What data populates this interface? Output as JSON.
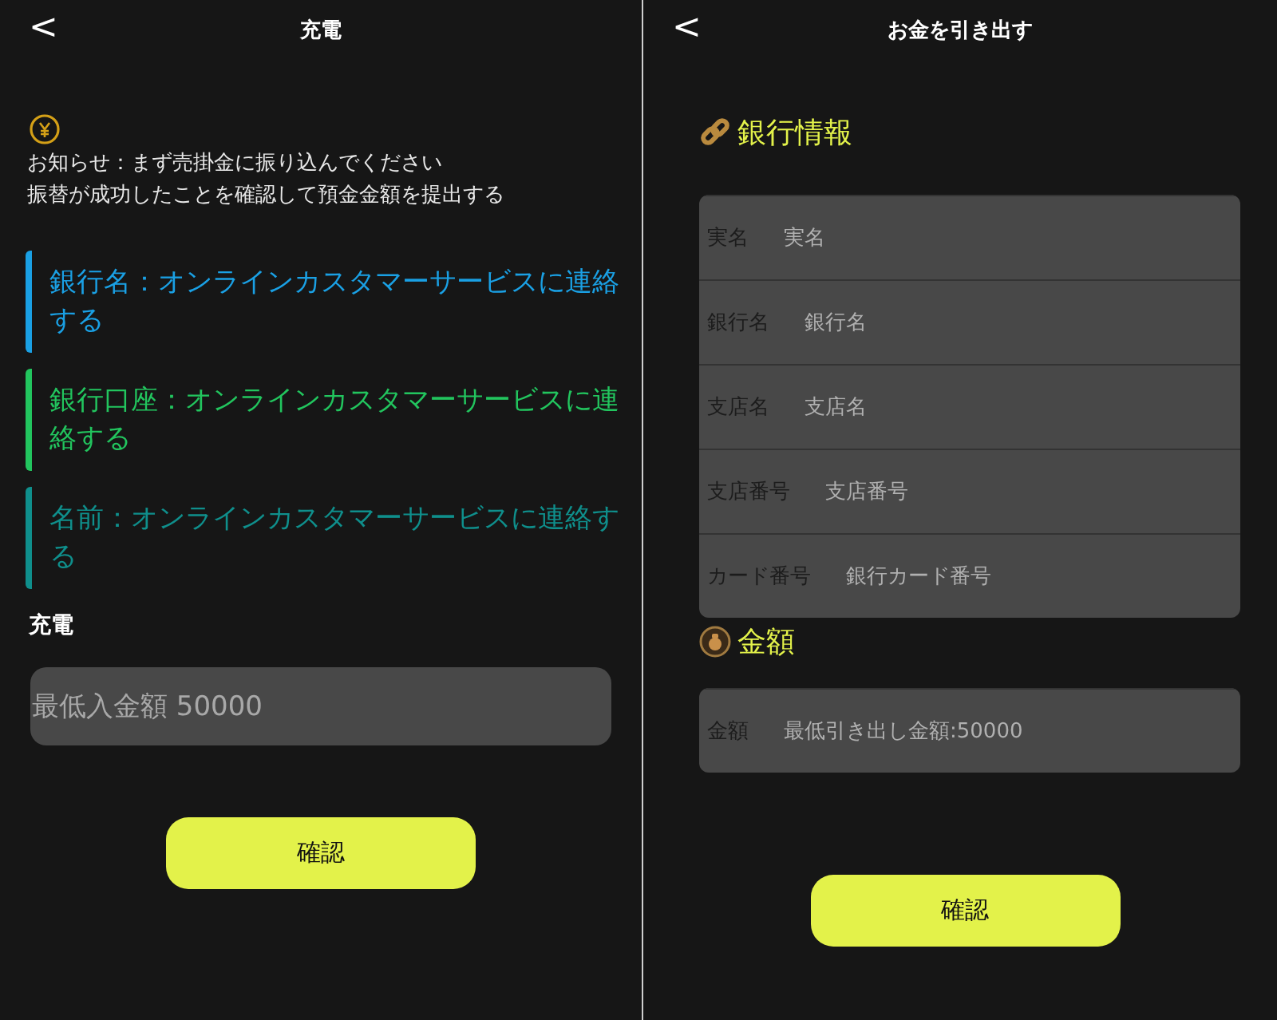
{
  "deposit": {
    "title": "充電",
    "back_icon": "<",
    "notice": [
      "お知らせ：まず売掛金に振り込んでください",
      "振替が成功したことを確認して預金金額を提出する"
    ],
    "info_blocks": [
      {
        "text": "銀行名：オンラインカスタマーサービスに連絡する",
        "color": "#1aa0e4"
      },
      {
        "text": "銀行口座：オンラインカスタマーサービスに連絡する",
        "color": "#22c55e"
      },
      {
        "text": "名前：オンラインカスタマーサービスに連絡する",
        "color": "#0f8f8c"
      }
    ],
    "amount_label": "充電",
    "amount_field": {
      "placeholder": "最低入金額 50000"
    },
    "confirm_button": "確認"
  },
  "withdraw": {
    "title": "お金を引き出す",
    "back_icon": "<",
    "bank_section": {
      "title": "銀行情報",
      "fields": [
        {
          "label": "実名",
          "placeholder": "実名"
        },
        {
          "label": "銀行名",
          "placeholder": "銀行名"
        },
        {
          "label": "支店名",
          "placeholder": "支店名"
        },
        {
          "label": "支店番号",
          "placeholder": "支店番号"
        },
        {
          "label": "カード番号",
          "placeholder": "銀行カード番号"
        }
      ]
    },
    "amount_section": {
      "title": "金額",
      "fields": [
        {
          "label": "金額",
          "placeholder": "最低引き出し金額:50000"
        }
      ]
    },
    "confirm_button": "確認"
  }
}
